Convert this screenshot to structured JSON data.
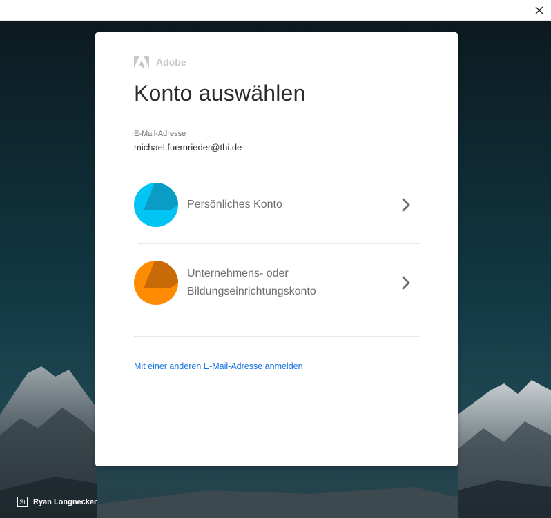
{
  "window": {
    "close_icon": "close-icon"
  },
  "background": {
    "photo_credit_badge": "St",
    "photo_credit_name": "Ryan Longnecker"
  },
  "card": {
    "brand_name": "Adobe",
    "brand_icon": "adobe-logo-icon",
    "title": "Konto auswählen",
    "email_label": "E-Mail-Adresse",
    "email_value": "michael.fuernrieder@thi.de",
    "accounts": [
      {
        "label": "Persönliches Konto",
        "avatar_color": "#00c4f3",
        "avatar_shade": "#0a9cc4",
        "icon": "chevron-right-icon"
      },
      {
        "label_line1": "Unternehmens- oder",
        "label_line2": "Bildungseinrichtungskonto",
        "avatar_color": "#ff8c00",
        "avatar_shade": "#c86a08",
        "icon": "chevron-right-icon"
      }
    ],
    "alt_link": "Mit einer anderen E-Mail-Adresse anmelden"
  },
  "colors": {
    "link": "#1473e6",
    "title_text": "#2c2c2c",
    "muted_text": "#6e6e6e"
  }
}
